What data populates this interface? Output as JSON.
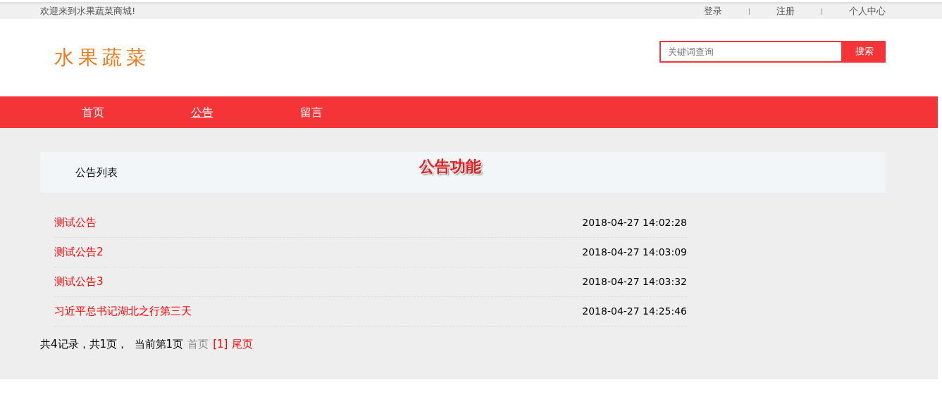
{
  "top_bar": {
    "welcome": "欢迎来到水果蔬菜商城!",
    "links": [
      "登录",
      "注册",
      "个人中心"
    ]
  },
  "header": {
    "logo": "水果蔬菜",
    "search": {
      "placeholder": "关键词查询",
      "button": "搜索"
    }
  },
  "nav": [
    {
      "label": "首页",
      "selected": false
    },
    {
      "label": "公告",
      "selected": true
    },
    {
      "label": "留言",
      "selected": false
    }
  ],
  "panel": {
    "title": "公告列表",
    "overlay_title": "公告功能"
  },
  "notices": [
    {
      "title": "测试公告",
      "time": "2018-04-27 14:02:28"
    },
    {
      "title": "测试公告2",
      "time": "2018-04-27 14:03:09"
    },
    {
      "title": "测试公告3",
      "time": "2018-04-27 14:03:32"
    },
    {
      "title": "习近平总书记湖北之行第三天",
      "time": "2018-04-27 14:25:46"
    }
  ],
  "pagination": {
    "summary": "共4记录，共1页，  当前第1页",
    "links": [
      {
        "label": "首页",
        "disabled": true
      },
      {
        "label": "[1]",
        "disabled": false
      },
      {
        "label": "尾页",
        "disabled": false
      }
    ]
  }
}
